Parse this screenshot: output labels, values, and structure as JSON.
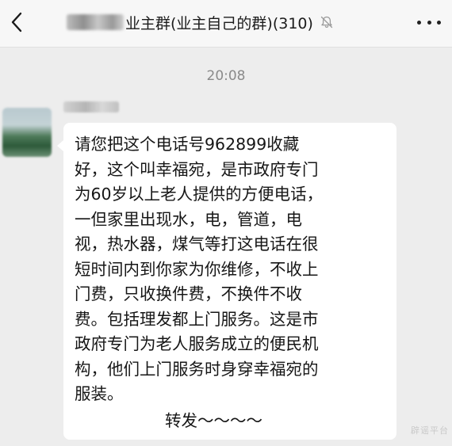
{
  "header": {
    "title_visible": "业主群(业主自己的群)(310)",
    "back_icon": "chevron-left-icon",
    "mute_icon": "bell-off-icon",
    "more_icon": "more-dots-icon"
  },
  "chat": {
    "timestamp": "20:08",
    "message": {
      "lines": [
        "请您把这个电话号962899收藏",
        "好，这个叫幸福宛，是市政府专门",
        "为60岁以上老人提供的方便电话，",
        "一但家里出现水，电，管道，电",
        "视，热水器，煤气等打这电话在很",
        "短时间内到你家为你维修，不收上",
        "门费，只收换件费，不换件不收",
        "费。包括理发都上门服务。这是市",
        "政府专门为老人服务成立的便民机",
        "构，他们上门服务时身穿幸福宛的",
        "服装。"
      ],
      "forward": "转发～～～～"
    }
  },
  "watermark": "辟谣平台"
}
